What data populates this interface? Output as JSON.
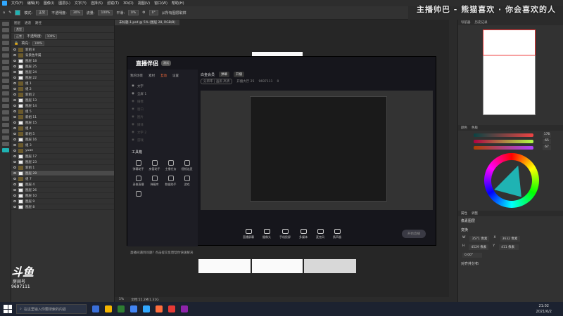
{
  "menubar": {
    "items": [
      "文件(F)",
      "编辑(E)",
      "图像(I)",
      "图层(L)",
      "文字(Y)",
      "选择(S)",
      "滤镜(T)",
      "3D(D)",
      "视图(V)",
      "窗口(W)",
      "帮助(H)"
    ]
  },
  "options": {
    "mode": "正常",
    "opacity_label": "不透明度:",
    "opacity": "30%",
    "flow_label": "流量:",
    "flow": "100%",
    "smoothing_label": "平滑:",
    "smoothing": "0%",
    "angle": "0°",
    "sample_label": "从所有图层取样",
    "accent": "#1fb3b3"
  },
  "watermark": "主播帅巴 - 熊猫喜欢 · 你会喜欢的人",
  "document_tab": "未标题-1.psd @ 5% (图层 28, RGB/8)",
  "layers_panel": {
    "tabs": [
      "图层",
      "通道",
      "路径"
    ],
    "kind": "类型",
    "blend": "正常",
    "opacity_label": "不透明度:",
    "opacity": "100%",
    "fill_label": "填充:",
    "fill": "100%",
    "layers": [
      {
        "name": "新组 8",
        "type": "group"
      },
      {
        "name": "背景色专属",
        "type": "group"
      },
      {
        "name": "图层 18",
        "type": "layer"
      },
      {
        "name": "图层 25",
        "type": "layer"
      },
      {
        "name": "图层 24",
        "type": "layer"
      },
      {
        "name": "图层 22",
        "type": "layer"
      },
      {
        "name": "组 1",
        "type": "group"
      },
      {
        "name": "组 2",
        "type": "group"
      },
      {
        "name": "新组 2",
        "type": "group"
      },
      {
        "name": "图层 13",
        "type": "layer"
      },
      {
        "name": "图层 14",
        "type": "layer"
      },
      {
        "name": "组 5",
        "type": "group"
      },
      {
        "name": "新组 11",
        "type": "group"
      },
      {
        "name": "图层 15",
        "type": "layer"
      },
      {
        "name": "组 4",
        "type": "group"
      },
      {
        "name": "新组 5",
        "type": "group"
      },
      {
        "name": "图层 16",
        "type": "layer"
      },
      {
        "name": "组 3",
        "type": "group"
      },
      {
        "name": "yuan",
        "type": "group"
      },
      {
        "name": "图层 17",
        "type": "layer"
      },
      {
        "name": "图层 23",
        "type": "layer"
      },
      {
        "name": "新组 1",
        "type": "group"
      },
      {
        "name": "图层 28",
        "type": "layer",
        "selected": true
      },
      {
        "name": "组 7",
        "type": "group"
      },
      {
        "name": "图层 4",
        "type": "layer"
      },
      {
        "name": "图层 26",
        "type": "layer"
      },
      {
        "name": "图层 10",
        "type": "layer"
      },
      {
        "name": "图层 9",
        "type": "layer"
      },
      {
        "name": "图层 8",
        "type": "layer"
      }
    ]
  },
  "streaming_app": {
    "logo": "直播伴侣",
    "version": "测试",
    "side_menu": [
      "我的场景",
      "素材",
      "互动",
      "设置"
    ],
    "side_menu_active": 2,
    "sources": [
      {
        "label": "文字",
        "enabled": true
      },
      {
        "label": "全屏 1",
        "enabled": true
      },
      {
        "label": "摄像",
        "enabled": false
      },
      {
        "label": "窗口",
        "enabled": false
      },
      {
        "label": "图片",
        "enabled": false
      },
      {
        "label": "媒体",
        "enabled": false
      },
      {
        "label": "文字 2",
        "enabled": false
      },
      {
        "label": "游戏",
        "enabled": false
      }
    ],
    "tools_title": "工具箱",
    "tools": [
      "弹幕助手",
      "房管助手",
      "主播任务",
      "视频连麦",
      "录像直播",
      "弹幕库",
      "数据助手",
      "游戏",
      ""
    ],
    "title_row": {
      "title": "白金会员",
      "badge": "弹幕",
      "btn": "开播"
    },
    "sub_row": {
      "pill": "分辨率 | 画质 高清",
      "fans": "开播大厅 25",
      "room": "9697111",
      "likes": "0"
    },
    "bottom_tools": [
      "直播屏幕",
      "摄像头",
      "手机投屏",
      "多媒体",
      "麦克风",
      "扬声器"
    ],
    "start_label": "开始直播",
    "notice": "直播间遇到问题? 点击提交反馈帮你快速解决"
  },
  "navigator": {
    "tabs": [
      "导航器",
      "历史记录"
    ]
  },
  "color_panel": {
    "tabs": [
      "颜色",
      "色板"
    ],
    "r": "176",
    "g": "65",
    "b": "67"
  },
  "properties": {
    "tabs": [
      "属性",
      "调整"
    ],
    "title": "像素图层",
    "transform_label": "变换",
    "w_label": "W",
    "w": "3571 像素",
    "h_label": "H",
    "h": "4529 像素",
    "x_label": "X",
    "x": "3632 像素",
    "y_label": "Y",
    "y": "411 像素",
    "angle": "0.00°",
    "align_label": "对齐并分布"
  },
  "statusbar": {
    "zoom": "5%",
    "doc": "文档:55.2M/1.31G"
  },
  "brand": {
    "logo": "斗鱼",
    "sub": "房间号",
    "room": "9697111"
  },
  "taskbar": {
    "search_placeholder": "在这里输入你要搜索的内容",
    "time": "21:02",
    "date": "2021/6/2"
  }
}
